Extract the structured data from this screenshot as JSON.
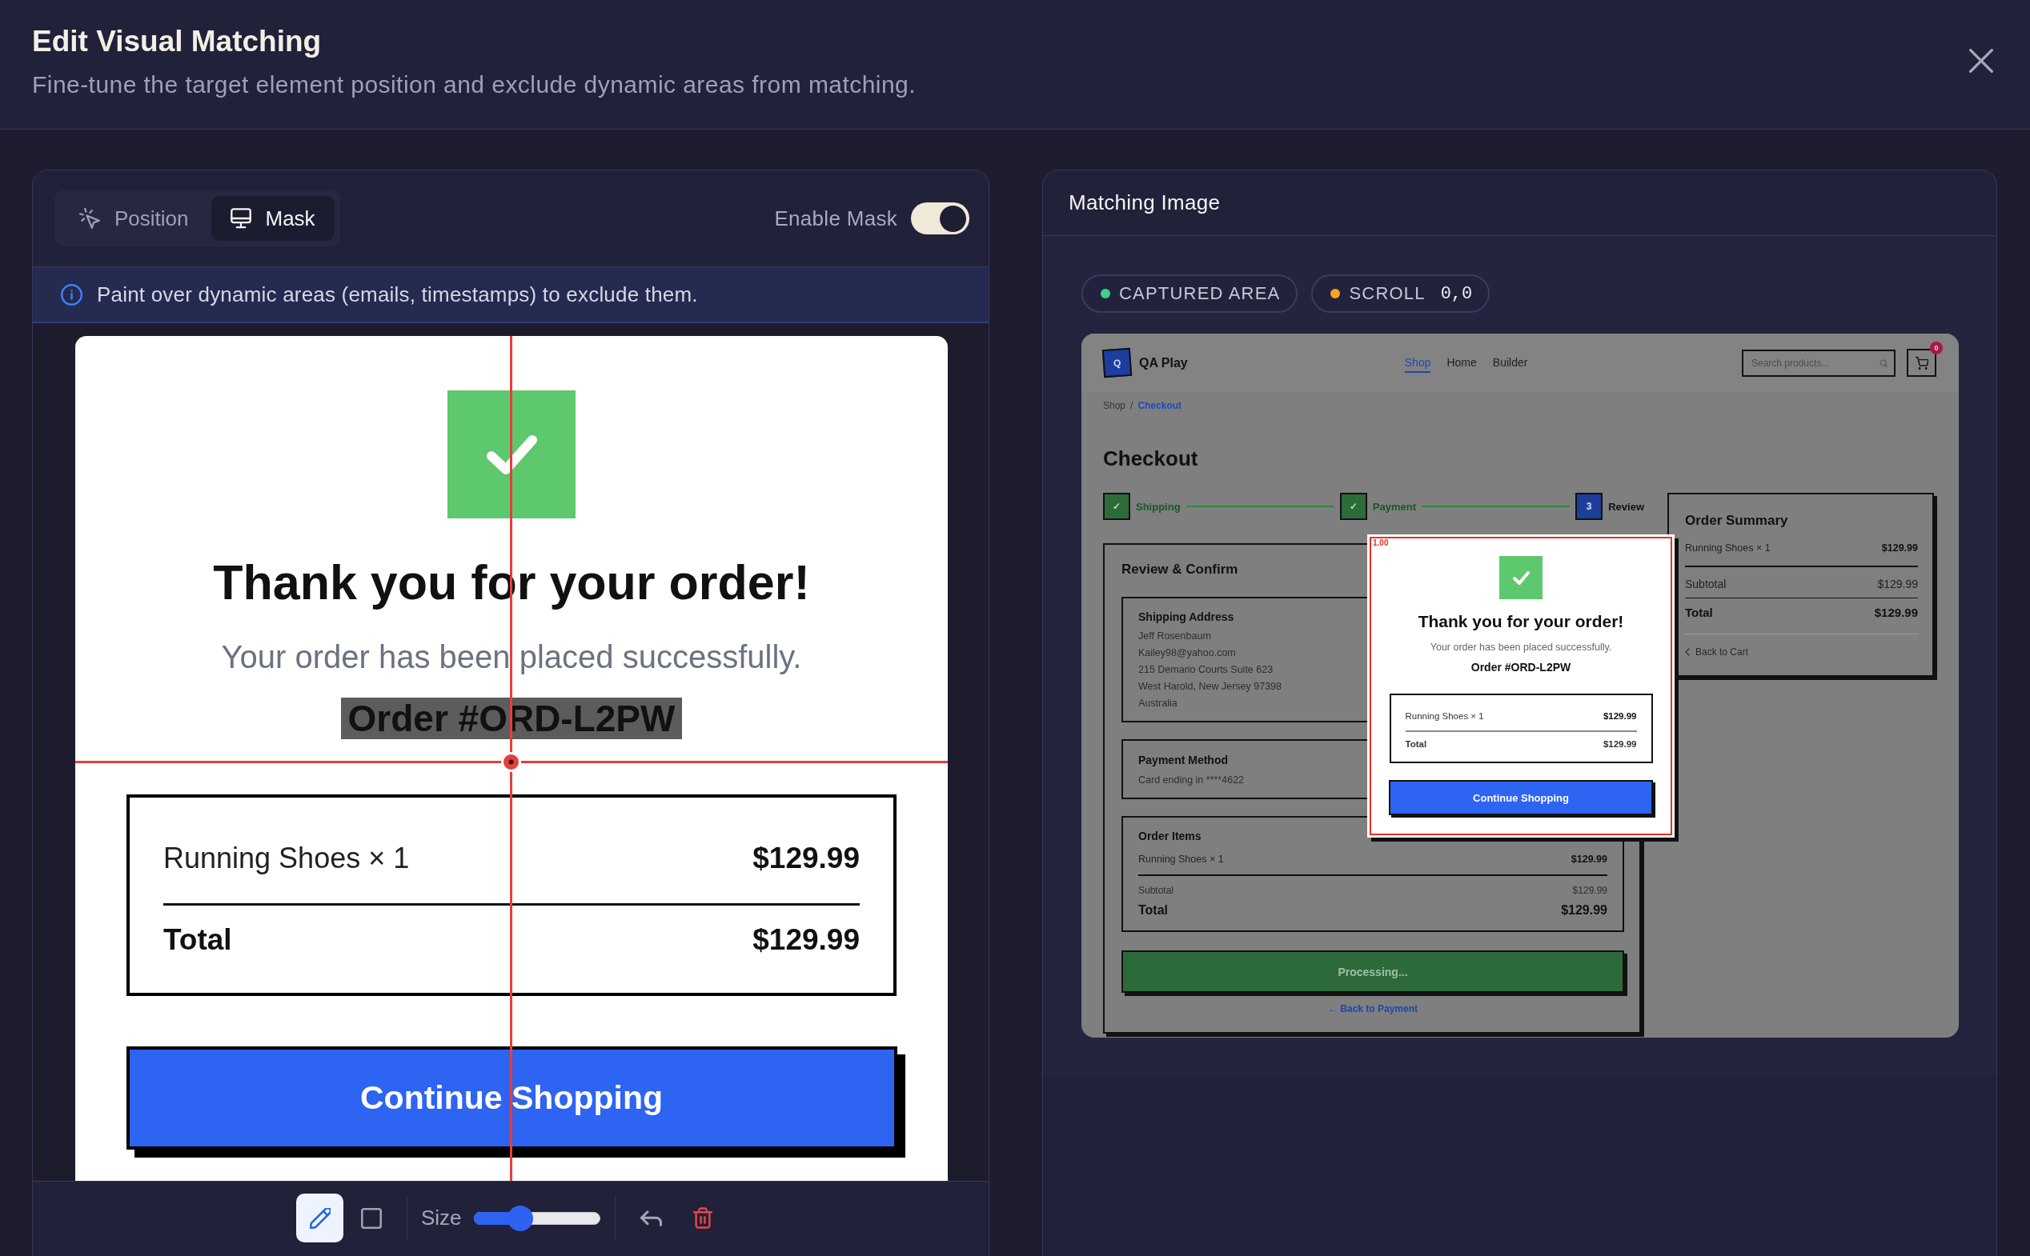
{
  "dialog": {
    "title": "Edit Visual Matching",
    "subtitle": "Fine-tune the target element position and exclude dynamic areas from matching."
  },
  "editor": {
    "tabs": [
      {
        "kind": "position",
        "label": "Position",
        "selected": false
      },
      {
        "kind": "mask",
        "label": "Mask",
        "selected": true
      }
    ],
    "mask_toggle": {
      "label": "Enable Mask",
      "on": true
    },
    "info": "Paint over dynamic areas (emails, timestamps) to exclude them.",
    "preview": {
      "title": "Thank you for your order!",
      "message": "Your order has been placed successfully.",
      "order": {
        "text": "Order #ORD-L2PW",
        "masked": true
      },
      "items": [
        {
          "name": "Running Shoes × 1",
          "price": "$129.99"
        }
      ],
      "total": {
        "label": "Total",
        "price": "$129.99"
      },
      "button": "Continue Shopping"
    },
    "tools": [
      {
        "kind": "brush",
        "selected": true
      },
      {
        "kind": "rectangle",
        "selected": false
      }
    ],
    "size": {
      "label": "Size",
      "level": 0.37
    }
  },
  "matching": {
    "title": "Matching Image",
    "badges": [
      {
        "label": "CAPTURED AREA",
        "color": "#3ecf8e"
      },
      {
        "label": "SCROLL",
        "value": "0,0",
        "color": "#f5a623"
      }
    ],
    "screenshot": {
      "brand": {
        "logo": "Q",
        "name": "QA Play"
      },
      "nav": [
        {
          "label": "Shop",
          "selected": true
        },
        {
          "label": "Home",
          "selected": false
        },
        {
          "label": "Builder",
          "selected": false
        }
      ],
      "search": {
        "placeholder": "Search products..."
      },
      "cart_count": "0",
      "breadcrumb": {
        "items": [
          {
            "label": "Shop",
            "current": false
          },
          {
            "label": "Checkout",
            "current": true
          }
        ],
        "separator": "/"
      },
      "heading": "Checkout",
      "steps": [
        {
          "marker": "✓",
          "label": "Shipping",
          "done": true
        },
        {
          "marker": "✓",
          "label": "Payment",
          "done": true
        },
        {
          "marker": "3",
          "label": "Review",
          "done": false
        }
      ],
      "review": {
        "title": "Review & Confirm",
        "shipping": {
          "title": "Shipping Address",
          "lines": [
            "Jeff Rosenbaum",
            "Kailey98@yahoo.com",
            "215 Demario Courts Suite 623",
            "West Harold, New Jersey 97398",
            "Australia"
          ]
        },
        "payment": {
          "title": "Payment Method",
          "lines": [
            "Card ending in ****4622"
          ]
        },
        "order_items": {
          "title": "Order Items",
          "items": [
            {
              "name": "Running Shoes × 1",
              "price": "$129.99"
            }
          ],
          "subtotal": {
            "label": "Subtotal",
            "price": "$129.99"
          },
          "total": {
            "label": "Total",
            "price": "$129.99"
          }
        },
        "button": "Processing...",
        "back_link": "← Back to Payment"
      },
      "summary": {
        "title": "Order Summary",
        "items": [
          {
            "name": "Running Shoes × 1",
            "price": "$129.99"
          }
        ],
        "subtotal": {
          "label": "Subtotal",
          "price": "$129.99"
        },
        "total": {
          "label": "Total",
          "price": "$129.99"
        },
        "back_link": "Back to Cart"
      },
      "match": {
        "score": "1.00",
        "popup": {
          "title": "Thank you for your order!",
          "message": "Your order has been placed successfully.",
          "order": "Order #ORD-L2PW",
          "items": [
            {
              "name": "Running Shoes × 1",
              "price": "$129.99"
            }
          ],
          "total": {
            "label": "Total",
            "price": "$129.99"
          },
          "button": "Continue Shopping"
        }
      }
    }
  }
}
